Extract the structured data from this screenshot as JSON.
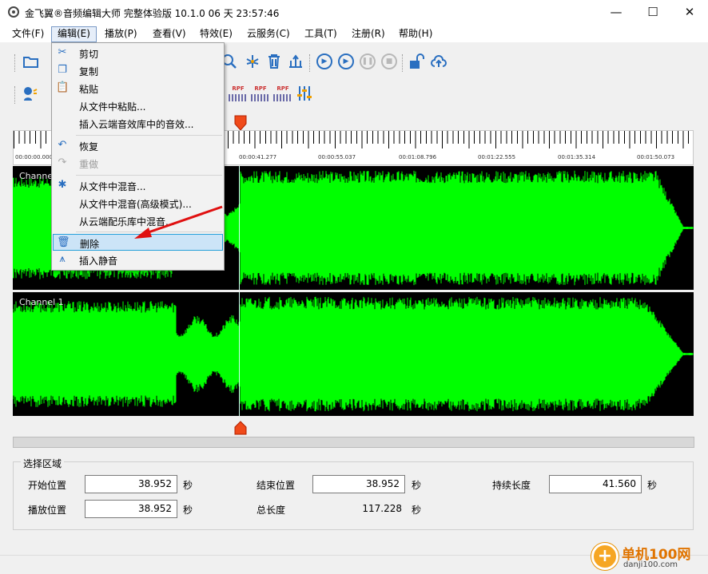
{
  "window": {
    "title": "金飞翼®音频编辑大师 完整体验版 10.1.0 06 天 23:57:46",
    "minimize": "—",
    "maximize": "☐",
    "close": "✕"
  },
  "menubar": [
    {
      "label": "文件(F)"
    },
    {
      "label": "编辑(E)"
    },
    {
      "label": "播放(P)"
    },
    {
      "label": "查看(V)"
    },
    {
      "label": "特效(E)"
    },
    {
      "label": "云服务(C)"
    },
    {
      "label": "工具(T)"
    },
    {
      "label": "注册(R)"
    },
    {
      "label": "帮助(H)"
    }
  ],
  "edit_menu": {
    "items": [
      {
        "label": "剪切",
        "icon": "scissors-icon"
      },
      {
        "label": "复制",
        "icon": "copy-icon"
      },
      {
        "label": "粘贴",
        "icon": "paste-icon"
      },
      {
        "label": "从文件中粘贴..."
      },
      {
        "label": "插入云端音效库中的音效..."
      },
      {
        "label": "恢复",
        "icon": "undo-icon"
      },
      {
        "label": "重做",
        "icon": "redo-icon",
        "disabled": true
      },
      {
        "label": "从文件中混音...",
        "icon": "mix-icon"
      },
      {
        "label": "从文件中混音(高级模式)..."
      },
      {
        "label": "从云端配乐库中混音..."
      },
      {
        "label": "删除",
        "icon": "trash-icon",
        "highlighted": true
      },
      {
        "label": "插入静音",
        "icon": "silence-icon"
      }
    ]
  },
  "toolbar": {
    "rpf_label": "RPF"
  },
  "ruler": {
    "labels": [
      "00:00:00.000",
      "00:00:41.277",
      "00:00:55.037",
      "00:01:08.796",
      "00:01:22.555",
      "00:01:35.314",
      "00:01:50.073"
    ]
  },
  "channels": [
    {
      "label": "Channel 0"
    },
    {
      "label": "Channel 1"
    }
  ],
  "waveform_color": "#00ff00",
  "selection": {
    "title": "选择区域",
    "start_label": "开始位置",
    "start_value": "38.952",
    "end_label": "结束位置",
    "end_value": "38.952",
    "duration_label": "持续长度",
    "duration_value": "41.560",
    "play_label": "播放位置",
    "play_value": "38.952",
    "total_label": "总长度",
    "total_value": "117.228",
    "unit": "秒"
  },
  "watermark": {
    "cn": "单机100网",
    "en": "danji100.com"
  }
}
